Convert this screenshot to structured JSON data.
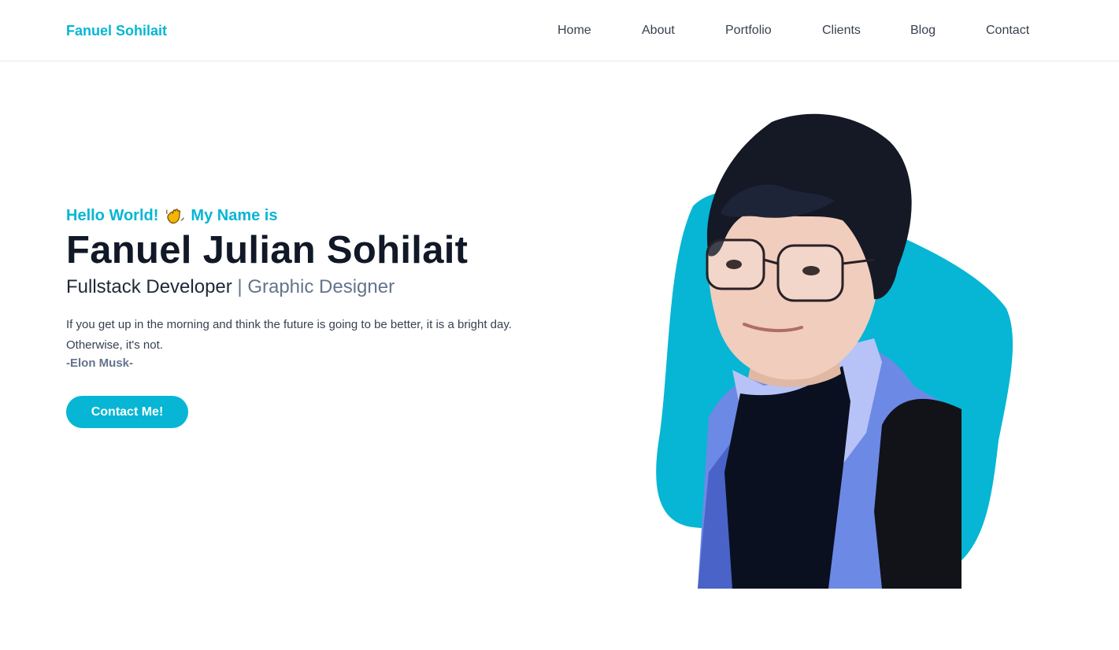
{
  "nav": {
    "brand": "Fanuel Sohilait",
    "links": [
      "Home",
      "About",
      "Portfolio",
      "Clients",
      "Blog",
      "Contact"
    ]
  },
  "hero": {
    "greeting_start": "Hello World!",
    "greeting_icon": "waving-hand-icon",
    "greeting_end": "My Name is",
    "name": "Fanuel Julian Sohilait",
    "role_primary": "Fullstack Developer",
    "role_secondary": "| Graphic Designer",
    "quote": "If you get up in the morning and think the future is going to be better, it is a bright day. Otherwise, it's not.",
    "quote_author": "-Elon Musk-",
    "cta_label": "Contact Me!"
  },
  "colors": {
    "accent": "#06b6d4",
    "heading": "#111827",
    "muted": "#64748b"
  }
}
